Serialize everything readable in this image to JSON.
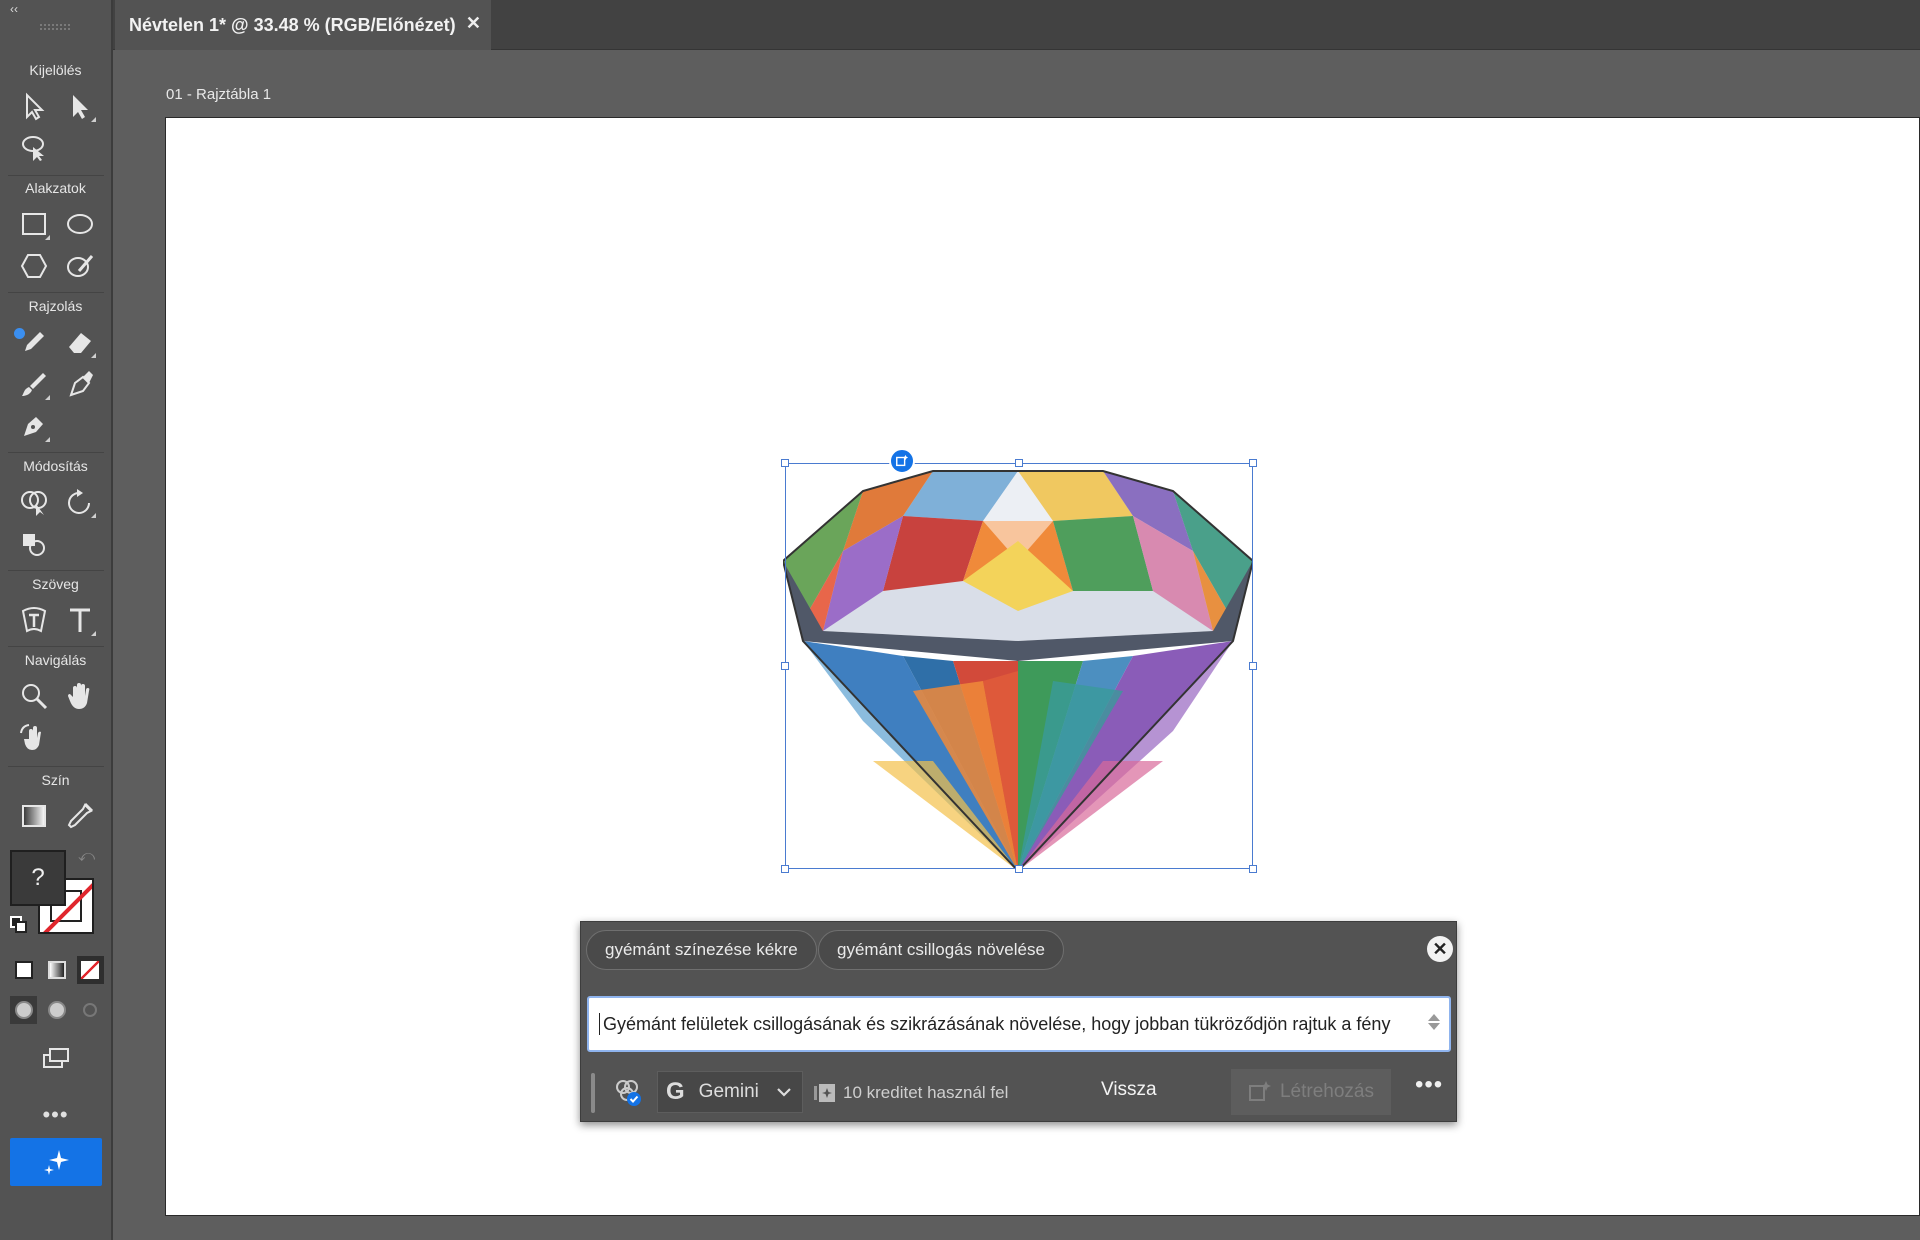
{
  "document": {
    "tab_title": "Névtelen 1* @ 33.48 % (RGB/Előnézet)",
    "artboard_label": "01 - Rajztábla 1"
  },
  "toolbar": {
    "collapse_glyph": "‹‹",
    "sections": {
      "selection": "Kijelölés",
      "shapes": "Alakzatok",
      "drawing": "Rajzolás",
      "modify": "Módosítás",
      "text": "Szöveg",
      "navigation": "Navigálás",
      "color": "Szín"
    },
    "fill_unknown": "?",
    "more": "•••",
    "accent_color": "#1473e6"
  },
  "panel": {
    "suggestions": [
      "gyémánt színezése kékre",
      "gyémánt csillogás növelése"
    ],
    "prompt_value": "Gyémánt felületek csillogásának és szikrázásának növelése, hogy jobban tükröződjön rajtuk a fény",
    "model": "Gemini",
    "credits_text": "10 kreditet használ fel",
    "back_label": "Vissza",
    "create_label": "Létrehozás",
    "more": "•••",
    "close": "✕"
  }
}
